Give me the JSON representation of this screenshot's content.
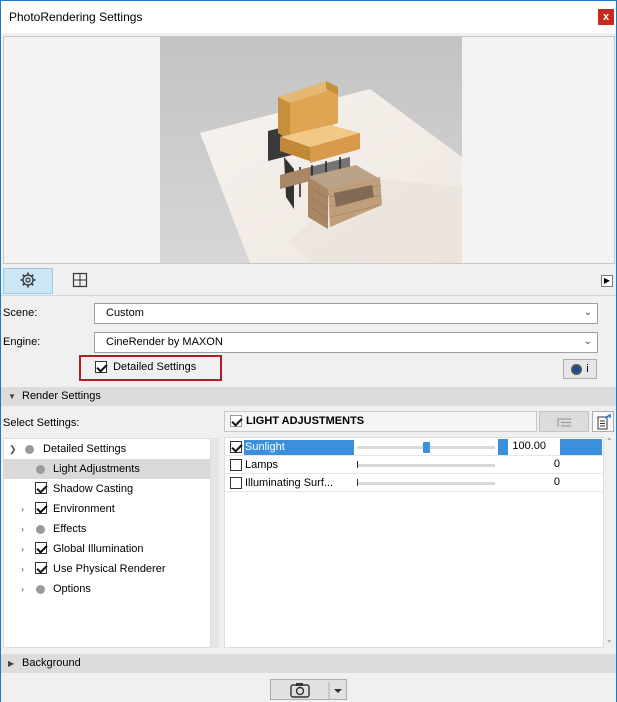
{
  "window": {
    "title": "PhotoRendering Settings",
    "close_label": "x"
  },
  "toolbar": {
    "settings_tab_icon": "gear-icon",
    "size_tab_icon": "crop-frame-icon",
    "expand_icon": "triangle-right-icon"
  },
  "scene": {
    "label": "Scene:",
    "value": "Custom"
  },
  "engine": {
    "label": "Engine:",
    "value": "CineRender by MAXON"
  },
  "detailed_settings": {
    "label": "Detailed Settings",
    "checked": true
  },
  "info_button": {
    "label": "i"
  },
  "render_settings": {
    "label": "Render Settings",
    "select_label": "Select Settings:"
  },
  "tree": {
    "items": [
      {
        "label": "Detailed Settings"
      },
      {
        "label": "Light Adjustments"
      },
      {
        "label": "Shadow Casting"
      },
      {
        "label": "Environment"
      },
      {
        "label": "Effects"
      },
      {
        "label": "Global Illumination"
      },
      {
        "label": "Use Physical Renderer"
      },
      {
        "label": "Options"
      }
    ]
  },
  "lights_panel": {
    "title": "LIGHT ADJUSTMENTS",
    "rows": [
      {
        "name": "Sunlight",
        "checked": true,
        "value": "100.00",
        "level": 0.5
      },
      {
        "name": "Lamps",
        "checked": false,
        "value": "0",
        "level": 0
      },
      {
        "name": "Illuminating Surf...",
        "checked": false,
        "value": "0",
        "level": 0
      }
    ]
  },
  "background": {
    "label": "Background"
  },
  "footer": {
    "render_icon": "camera-icon",
    "menu_icon": "dropdown-arrow-icon"
  },
  "colors": {
    "accent": "#3c8fdc",
    "highlight_border": "#b01e24",
    "close": "#c42b1c"
  }
}
